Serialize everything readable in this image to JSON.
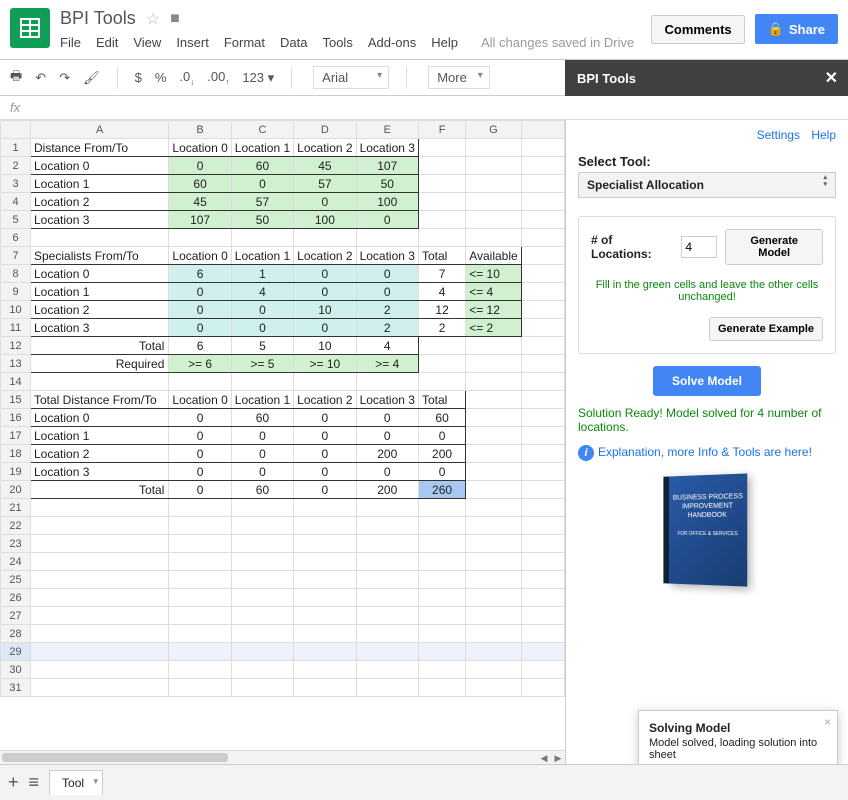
{
  "doc_title": "BPI Tools",
  "menu": [
    "File",
    "Edit",
    "View",
    "Insert",
    "Format",
    "Data",
    "Tools",
    "Add-ons",
    "Help"
  ],
  "saved_msg": "All changes saved in Drive",
  "comments_btn": "Comments",
  "share_btn": "Share",
  "toolbar": {
    "dollar": "$",
    "percent": "%",
    "dec0": ".0",
    "dec00": ".00",
    "num": "123",
    "font": "Arial",
    "more": "More"
  },
  "panel_title": "BPI Tools",
  "panel": {
    "settings": "Settings",
    "help": "Help",
    "select_label": "Select Tool:",
    "select_value": "Specialist Allocation",
    "loc_label": "# of Locations:",
    "loc_value": "4",
    "gen_model": "Generate Model",
    "hint": "Fill in the green cells and leave the other cells unchanged!",
    "gen_example": "Generate Example",
    "solve": "Solve Model",
    "status": "Solution Ready! Model solved for 4 number of locations.",
    "link": "Explanation, more Info & Tools are here!",
    "book": "BUSINESS PROCESS IMPROVEMENT HANDBOOK",
    "book2": "FOR OFFICE & SERVICES"
  },
  "toast": {
    "title": "Solving Model",
    "body": "Model solved, loading solution into sheet"
  },
  "tab_name": "Tool",
  "columns": [
    "A",
    "B",
    "C",
    "D",
    "E",
    "F",
    "G"
  ],
  "sheet": {
    "r1": [
      "Distance From/To",
      "Location 0",
      "Location 1",
      "Location 2",
      "Location 3"
    ],
    "r2": [
      "Location 0",
      "0",
      "60",
      "45",
      "107"
    ],
    "r3": [
      "Location 1",
      "60",
      "0",
      "57",
      "50"
    ],
    "r4": [
      "Location 2",
      "45",
      "57",
      "0",
      "100"
    ],
    "r5": [
      "Location 3",
      "107",
      "50",
      "100",
      "0"
    ],
    "r7": [
      "Specialists From/To",
      "Location 0",
      "Location 1",
      "Location 2",
      "Location 3",
      "Total",
      "Available"
    ],
    "r8": [
      "Location 0",
      "6",
      "1",
      "0",
      "0",
      "7",
      "<= 10"
    ],
    "r9": [
      "Location 1",
      "0",
      "4",
      "0",
      "0",
      "4",
      "<= 4"
    ],
    "r10": [
      "Location 2",
      "0",
      "0",
      "10",
      "2",
      "12",
      "<= 12"
    ],
    "r11": [
      "Location 3",
      "0",
      "0",
      "0",
      "2",
      "2",
      "<= 2"
    ],
    "r12": [
      "Total",
      "6",
      "5",
      "10",
      "4"
    ],
    "r13": [
      "Required",
      ">= 6",
      ">= 5",
      ">= 10",
      ">= 4"
    ],
    "r15": [
      "Total Distance From/To",
      "Location 0",
      "Location 1",
      "Location 2",
      "Location 3",
      "Total"
    ],
    "r16": [
      "Location 0",
      "0",
      "60",
      "0",
      "0",
      "60"
    ],
    "r17": [
      "Location 1",
      "0",
      "0",
      "0",
      "0",
      "0"
    ],
    "r18": [
      "Location 2",
      "0",
      "0",
      "0",
      "200",
      "200"
    ],
    "r19": [
      "Location 3",
      "0",
      "0",
      "0",
      "0",
      "0"
    ],
    "r20": [
      "Total",
      "0",
      "60",
      "0",
      "200",
      "260"
    ]
  },
  "chart_data": {
    "type": "table",
    "tables": [
      {
        "name": "Distance",
        "row_labels": [
          "Location 0",
          "Location 1",
          "Location 2",
          "Location 3"
        ],
        "col_labels": [
          "Location 0",
          "Location 1",
          "Location 2",
          "Location 3"
        ],
        "values": [
          [
            0,
            60,
            45,
            107
          ],
          [
            60,
            0,
            57,
            50
          ],
          [
            45,
            57,
            0,
            100
          ],
          [
            107,
            50,
            100,
            0
          ]
        ]
      },
      {
        "name": "Specialists",
        "row_labels": [
          "Location 0",
          "Location 1",
          "Location 2",
          "Location 3"
        ],
        "col_labels": [
          "Location 0",
          "Location 1",
          "Location 2",
          "Location 3"
        ],
        "values": [
          [
            6,
            1,
            0,
            0
          ],
          [
            0,
            4,
            0,
            0
          ],
          [
            0,
            0,
            10,
            2
          ],
          [
            0,
            0,
            0,
            2
          ]
        ],
        "row_totals": [
          7,
          4,
          12,
          2
        ],
        "available": [
          "<= 10",
          "<= 4",
          "<= 12",
          "<= 2"
        ],
        "col_totals": [
          6,
          5,
          10,
          4
        ],
        "required": [
          ">= 6",
          ">= 5",
          ">= 10",
          ">= 4"
        ]
      },
      {
        "name": "TotalDistance",
        "row_labels": [
          "Location 0",
          "Location 1",
          "Location 2",
          "Location 3"
        ],
        "col_labels": [
          "Location 0",
          "Location 1",
          "Location 2",
          "Location 3"
        ],
        "values": [
          [
            0,
            60,
            0,
            0
          ],
          [
            0,
            0,
            0,
            0
          ],
          [
            0,
            0,
            0,
            200
          ],
          [
            0,
            0,
            0,
            0
          ]
        ],
        "row_totals": [
          60,
          0,
          200,
          0
        ],
        "col_totals": [
          0,
          60,
          0,
          200
        ],
        "grand_total": 260
      }
    ]
  }
}
